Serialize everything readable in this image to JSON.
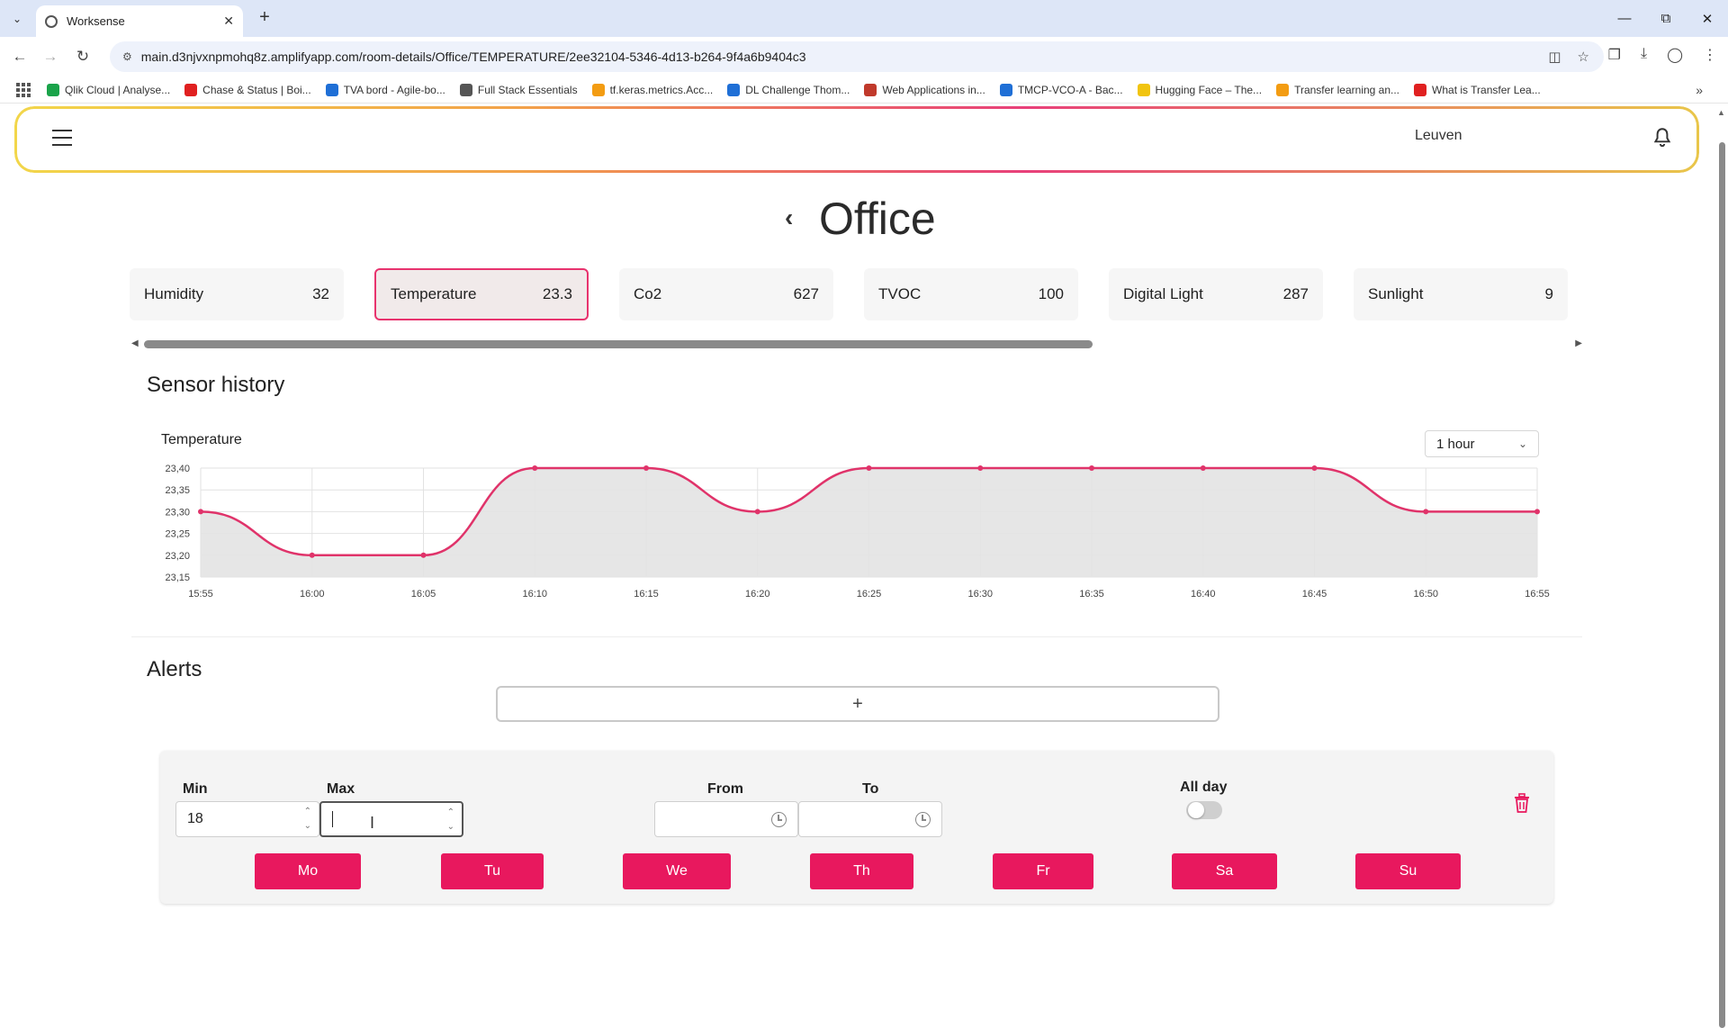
{
  "browser": {
    "tab_title": "Worksense",
    "url": "main.d3njvxnpmohq8z.amplifyapp.com/room-details/Office/TEMPERATURE/2ee32104-5346-4d13-b264-9f4a6b9404c3",
    "bookmarks": [
      {
        "label": "Qlik Cloud | Analyse...",
        "color": "#1aa34a"
      },
      {
        "label": "Chase & Status | Boi...",
        "color": "#e02020"
      },
      {
        "label": "TVA bord - Agile-bo...",
        "color": "#1f6fd6"
      },
      {
        "label": "Full Stack Essentials",
        "color": "#555555"
      },
      {
        "label": "tf.keras.metrics.Acc...",
        "color": "#f39c12"
      },
      {
        "label": "DL Challenge Thom...",
        "color": "#1f6fd6"
      },
      {
        "label": "Web Applications in...",
        "color": "#c0392b"
      },
      {
        "label": "TMCP-VCO-A - Bac...",
        "color": "#1f6fd6"
      },
      {
        "label": "Hugging Face – The...",
        "color": "#f1c40f"
      },
      {
        "label": "Transfer learning an...",
        "color": "#f39c12"
      },
      {
        "label": "What is Transfer Lea...",
        "color": "#e02020"
      }
    ]
  },
  "header": {
    "location": "Leuven"
  },
  "page": {
    "title": "Office"
  },
  "sensors": [
    {
      "name": "Humidity",
      "value": "32"
    },
    {
      "name": "Temperature",
      "value": "23.3"
    },
    {
      "name": "Co2",
      "value": "627"
    },
    {
      "name": "TVOC",
      "value": "100"
    },
    {
      "name": "Digital Light",
      "value": "287"
    },
    {
      "name": "Sunlight",
      "value": "9"
    }
  ],
  "active_sensor": "Temperature",
  "history": {
    "section_title": "Sensor history",
    "range_selected": "1 hour"
  },
  "chart_data": {
    "type": "area",
    "title": "Temperature",
    "x": [
      "15:55",
      "16:00",
      "16:05",
      "16:10",
      "16:15",
      "16:20",
      "16:25",
      "16:30",
      "16:35",
      "16:40",
      "16:45",
      "16:50",
      "16:55"
    ],
    "y_ticks": [
      "23,40",
      "23,35",
      "23,30",
      "23,25",
      "23,20",
      "23,15"
    ],
    "values": [
      23.3,
      23.2,
      23.2,
      23.4,
      23.4,
      23.3,
      23.4,
      23.4,
      23.4,
      23.4,
      23.4,
      23.3,
      23.3
    ],
    "ylim": [
      23.15,
      23.4
    ],
    "grid": true,
    "line_color": "#e0336a",
    "fill_color": "#e3e3e3"
  },
  "alerts": {
    "section_title": "Alerts",
    "add_label": "+",
    "rule": {
      "min_label": "Min",
      "min_value": "18",
      "max_label": "Max",
      "from_label": "From",
      "to_label": "To",
      "allday_label": "All day",
      "days": [
        "Mo",
        "Tu",
        "We",
        "Th",
        "Fr",
        "Sa",
        "Su"
      ]
    }
  },
  "colors": {
    "accent": "#e8185e"
  }
}
